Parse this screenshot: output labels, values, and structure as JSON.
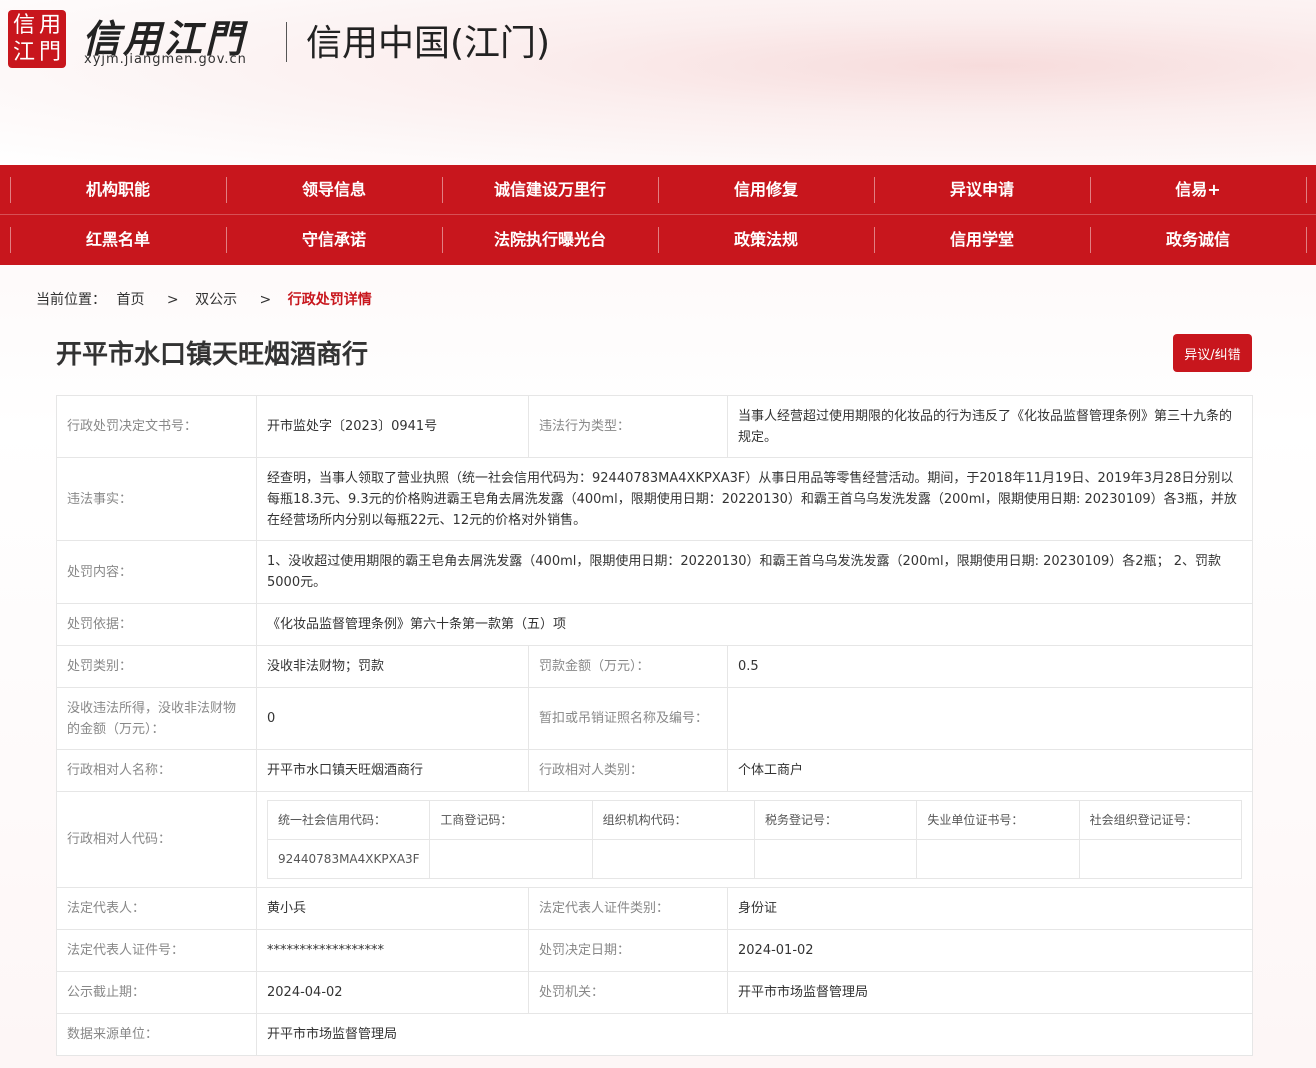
{
  "header": {
    "seal_chars": [
      "信",
      "用",
      "江",
      "門"
    ],
    "site_name": "信用江門",
    "url": "xyjm.jiangmen.gov.cn",
    "site_title": "信用中国(江门)"
  },
  "nav": {
    "row1": [
      "机构职能",
      "领导信息",
      "诚信建设万里行",
      "信用修复",
      "异议申请",
      "信易+"
    ],
    "row2": [
      "红黑名单",
      "守信承诺",
      "法院执行曝光台",
      "政策法规",
      "信用学堂",
      "政务诚信"
    ]
  },
  "breadcrumb": {
    "prefix": "当前位置：",
    "home": "首页",
    "sep": ">",
    "section": "双公示",
    "current": "行政处罚详情"
  },
  "title": "开平市水口镇天旺烟酒商行",
  "objection_button": "异议/纠错",
  "detail": {
    "decision_no_label": "行政处罚决定文书号：",
    "decision_no": "开市监处字〔2023〕0941号",
    "violation_type_label": "违法行为类型：",
    "violation_type": "当事人经营超过使用期限的化妆品的行为违反了《化妆品监督管理条例》第三十九条的规定。",
    "facts_label": "违法事实：",
    "facts": "经查明，当事人领取了营业执照（统一社会信用代码为：92440783MA4XKPXA3F）从事日用品等零售经营活动。期间，于2018年11月19日、2019年3月28日分别以每瓶18.3元、9.3元的价格购进霸王皂角去屑洗发露（400ml，限期使用日期：20220130）和霸王首乌乌发洗发露（200ml，限期使用日期: 20230109）各3瓶，并放在经营场所内分别以每瓶22元、12元的价格对外销售。",
    "content_label": "处罚内容：",
    "content": "1、没收超过使用期限的霸王皂角去屑洗发露（400ml，限期使用日期：20220130）和霸王首乌乌发洗发露（200ml，限期使用日期: 20230109）各2瓶； 2、罚款5000元。",
    "basis_label": "处罚依据：",
    "basis": "《化妆品监督管理条例》第六十条第一款第（五）项",
    "category_label": "处罚类别：",
    "category": "没收非法财物；罚款",
    "fine_label": "罚款金额（万元）：",
    "fine": "0.5",
    "confiscated_label": "没收违法所得，没收非法财物的金额（万元）：",
    "confiscated": "0",
    "license_label": "暂扣或吊销证照名称及编号：",
    "license": "",
    "party_name_label": "行政相对人名称：",
    "party_name": "开平市水口镇天旺烟酒商行",
    "party_type_label": "行政相对人类别：",
    "party_type": "个体工商户",
    "party_code_label": "行政相对人代码：",
    "codes": {
      "headers": [
        "统一社会信用代码：",
        "工商登记码：",
        "组织机构代码：",
        "税务登记号：",
        "失业单位证书号：",
        "社会组织登记证号："
      ],
      "values": [
        "92440783MA4XKPXA3F",
        "",
        "",
        "",
        "",
        ""
      ]
    },
    "legal_rep_label": "法定代表人：",
    "legal_rep": "黄小兵",
    "id_type_label": "法定代表人证件类别：",
    "id_type": "身份证",
    "id_no_label": "法定代表人证件号：",
    "id_no": "******************",
    "decision_date_label": "处罚决定日期：",
    "decision_date": "2024-01-02",
    "publicity_end_label": "公示截止期：",
    "publicity_end": "2024-04-02",
    "authority_label": "处罚机关：",
    "authority": "开平市市场监督管理局",
    "source_label": "数据来源单位：",
    "source": "开平市市场监督管理局"
  }
}
